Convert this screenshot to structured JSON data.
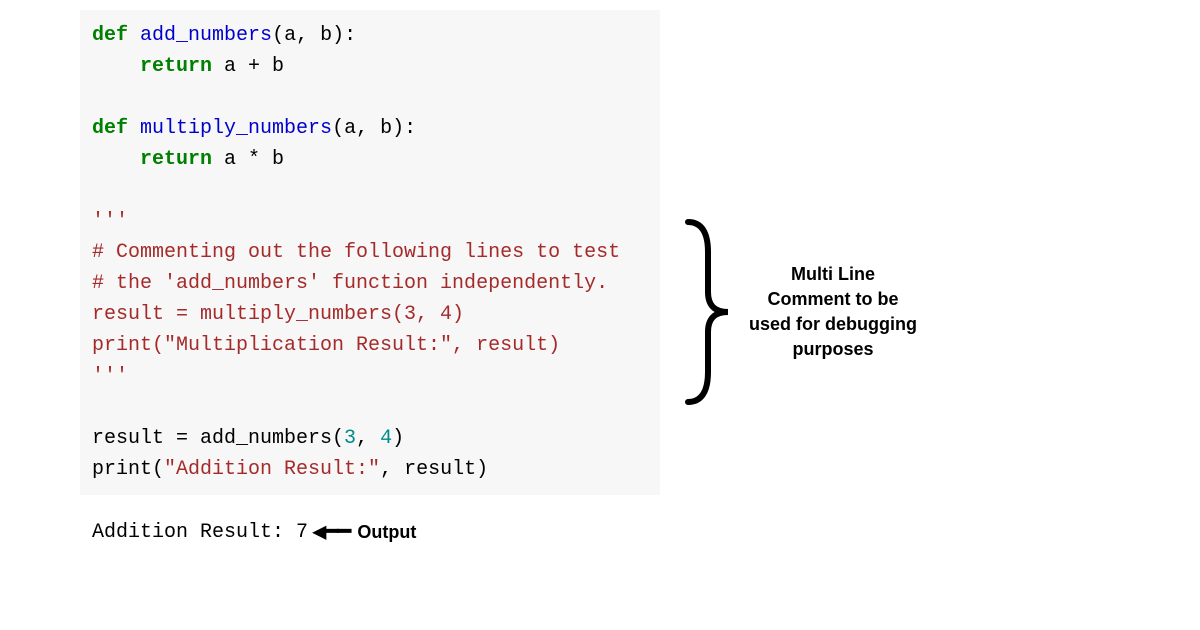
{
  "code": {
    "line1_def": "def",
    "line1_fn": "add_numbers",
    "line1_params": "(a, b):",
    "line2_return": "return",
    "line2_expr": " a + b",
    "line4_def": "def",
    "line4_fn": "multiply_numbers",
    "line4_params": "(a, b):",
    "line5_return": "return",
    "line5_expr": " a * b",
    "line7_triple": "'''",
    "line8_comment": "# Commenting out the following lines to test",
    "line9_comment": "# the 'add_numbers' function independently.",
    "line10_commented": "result = multiply_numbers(3, 4)",
    "line11_commented": "print(\"Multiplication Result:\", result)",
    "line12_triple": "'''",
    "line14_assign": "result = add_numbers(",
    "line14_arg1": "3",
    "line14_comma": ", ",
    "line14_arg2": "4",
    "line14_close": ")",
    "line15_print": "print(",
    "line15_str": "\"Addition Result:\"",
    "line15_rest": ", result)"
  },
  "output": {
    "text": "Addition Result: 7",
    "label": "Output"
  },
  "annotation": {
    "text": "Multi Line Comment to be used for debugging purposes"
  }
}
